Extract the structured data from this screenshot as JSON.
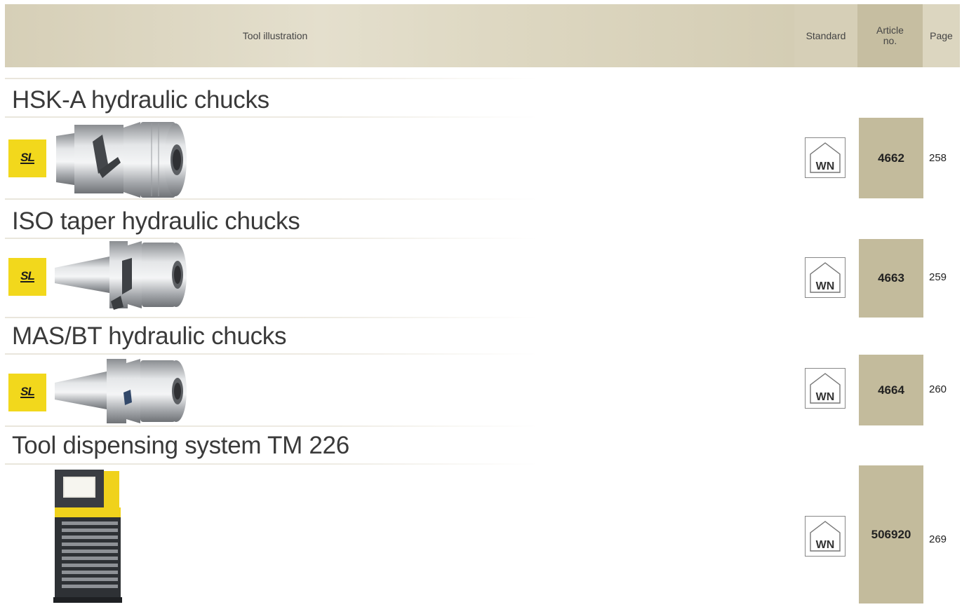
{
  "header": {
    "tool_illustration": "Tool illustration",
    "standard": "Standard",
    "article_no_line1": "Article",
    "article_no_line2": "no.",
    "page": "Page"
  },
  "sections": [
    {
      "title": "HSK-A hydraulic chucks",
      "badge": "SL",
      "standard_icon": "WN",
      "article_no": "4662",
      "page": "258"
    },
    {
      "title": "ISO taper hydraulic chucks",
      "badge": "SL",
      "standard_icon": "WN",
      "article_no": "4663",
      "page": "259"
    },
    {
      "title": "MAS/BT hydraulic chucks",
      "badge": "SL",
      "standard_icon": "WN",
      "article_no": "4664",
      "page": "260"
    },
    {
      "title": "Tool dispensing system TM 226",
      "standard_icon": "WN",
      "article_no": "506920",
      "page": "269"
    }
  ],
  "colors": {
    "header_bg": "#d6cfb7",
    "article_bg": "#c3bb9c",
    "badge_yellow": "#f2d81c"
  }
}
